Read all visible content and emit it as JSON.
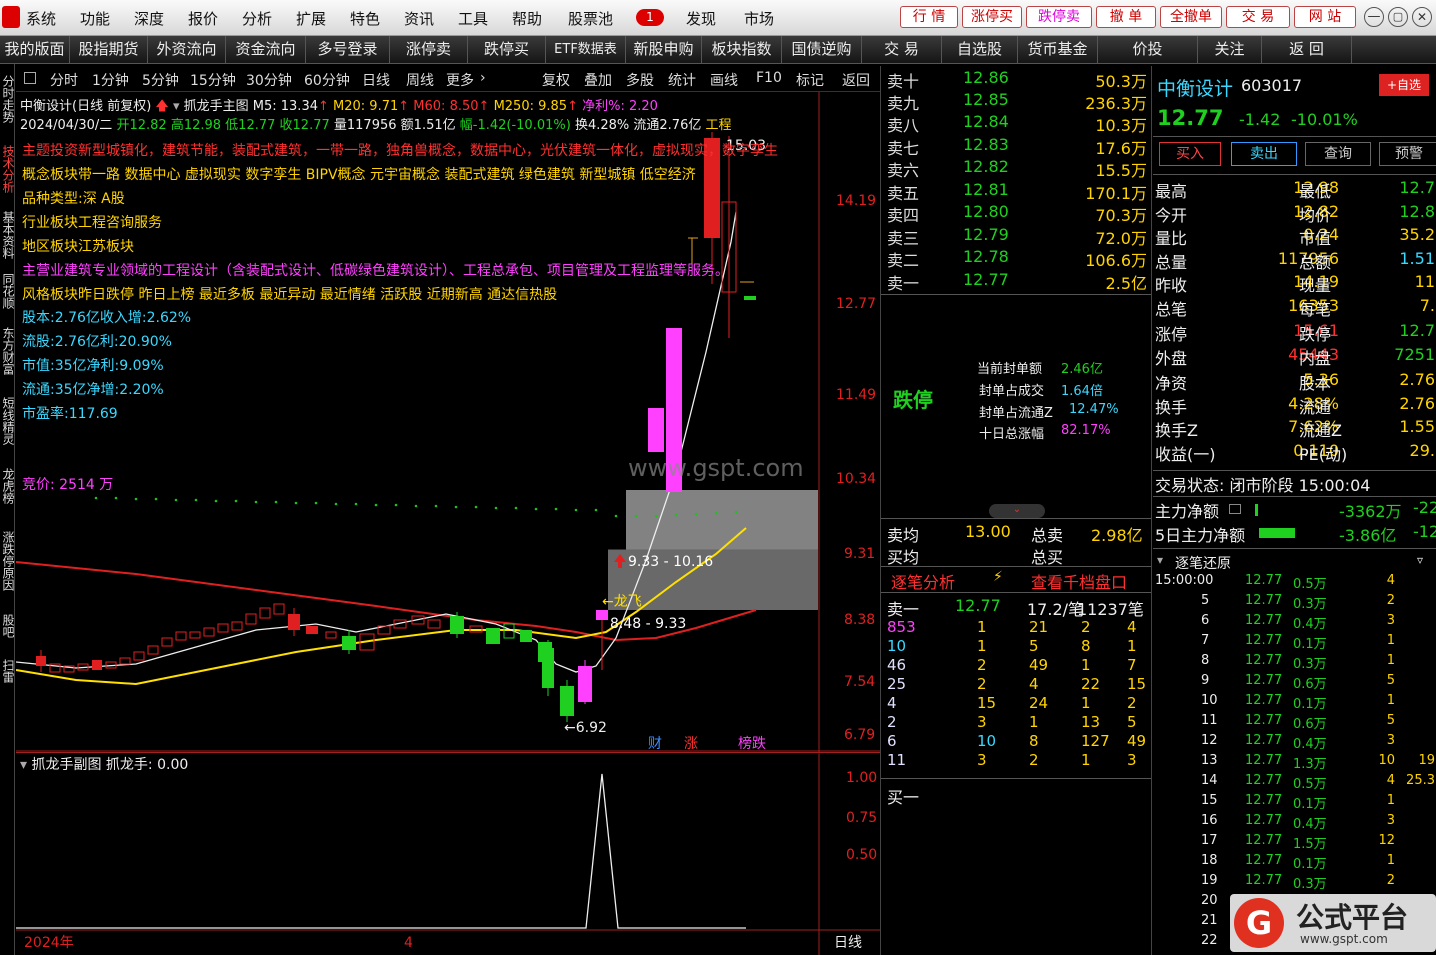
{
  "menu": {
    "items": [
      "系统",
      "功能",
      "深度",
      "报价",
      "分析",
      "扩展",
      "特色",
      "资讯",
      "工具",
      "帮助"
    ],
    "stockpool": "股票池",
    "badge": "1",
    "discover": "发现",
    "market": "市场",
    "right_buttons": [
      "行 情",
      "涨停买",
      "跌停卖",
      "撤 单",
      "全撤单",
      "交 易",
      "网 站"
    ]
  },
  "toolbar": {
    "items": [
      "我的版面",
      "股指期货",
      "外资流向",
      "资金流向",
      "多号登录",
      "涨停卖",
      "跌停买",
      "ETF数据表",
      "新股申购",
      "板块指数",
      "国债逆购",
      "交 易",
      "自选股",
      "货币基金",
      "价投",
      "关注",
      "返 回"
    ]
  },
  "leftstrip": [
    "分时走势",
    "技术分析",
    "基本资料",
    "同花顺",
    "东方财富",
    "短线精灵",
    "龙虎榜",
    "涨跌停原因",
    "股吧",
    "扫雷"
  ],
  "period": {
    "items": [
      "分时",
      "1分钟",
      "5分钟",
      "15分钟",
      "30分钟",
      "60分钟",
      "日线",
      "周线",
      "更多"
    ],
    "right": [
      "复权",
      "叠加",
      "多股",
      "统计",
      "画线",
      "F10",
      "标记",
      "返回"
    ]
  },
  "chart_header": {
    "title": "中衡设计(日线 前复权)",
    "main": "抓龙手主图",
    "m5": "M5: 13.34",
    "m20": "M20: 9.71",
    "m60": "M60: 8.50",
    "m250": "M250: 9.85",
    "jl": "净利%: 2.20",
    "line2a": "2024/04/30/二",
    "open": "开12.82",
    "high": "高12.98",
    "low": "低12.77",
    "close": "收12.77",
    "vol": "量117956",
    "amt": "额1.51亿",
    "chg": "幅-1.42(-10.01%)",
    "turn": "换4.28%",
    "flow": "流通2.76亿",
    "tail": "工程"
  },
  "overlay": {
    "theme": "主题投资新型城镇化，建筑节能，装配式建筑，一带一路，独角兽概念，数据中心，光伏建筑一体化，虚拟现实，数字孪生",
    "concept": "概念板块带一路 数据中心 虚拟现实 数字孪生 BIPV概念 元宇宙概念 装配式建筑 绿色建筑 新型城镇 低空经济",
    "type": "品种类型:深 A股",
    "industry": "行业板块工程咨询服务",
    "region": "地区板块江苏板块",
    "business": "主营业建筑专业领域的工程设计（含装配式设计、低碳绿色建筑设计）、工程总承包、项目管理及工程监理等服务。",
    "style": "风格板块昨日跌停 昨日上榜 最近多板 最近异动 最近情绪 活跃股 近期新高 通达信热股",
    "f1": "股本:2.76亿收入增:2.62%",
    "f2": "流股:2.76亿利:20.90%",
    "f3": "市值:35亿净利:9.09%",
    "f4": "流通:35亿净增:2.20%",
    "f5": "市盈率:117.69",
    "auction": "竞价: 2514 万"
  },
  "price_axis": [
    "14.19",
    "12.77",
    "11.49",
    "10.34",
    "9.31",
    "8.38",
    "7.54",
    "6.79"
  ],
  "sub_axis": [
    "1.00",
    "0.75",
    "0.50"
  ],
  "annotations": {
    "peak": "15.03",
    "zone": "9.33 - 10.16",
    "dragon": "←龙飞",
    "zone2": "8.48 - 9.33",
    "low": "←6.92",
    "tag1": "财",
    "tag2": "涨",
    "tag3": "榜跌",
    "watermark": "www.gspt.com"
  },
  "subchart": {
    "title": "抓龙手副图 抓龙手: 0.00",
    "year": "2024年",
    "month": "4",
    "period": "日线"
  },
  "orderbook": {
    "sells": [
      [
        "卖十",
        "12.86",
        "50.3万"
      ],
      [
        "卖九",
        "12.85",
        "236.3万"
      ],
      [
        "卖八",
        "12.84",
        "10.3万"
      ],
      [
        "卖七",
        "12.83",
        "17.6万"
      ],
      [
        "卖六",
        "12.82",
        "15.5万"
      ],
      [
        "卖五",
        "12.81",
        "170.1万"
      ],
      [
        "卖四",
        "12.80",
        "70.3万"
      ],
      [
        "卖三",
        "12.79",
        "72.0万"
      ],
      [
        "卖二",
        "12.78",
        "106.6万"
      ],
      [
        "卖一",
        "12.77",
        "2.5亿"
      ]
    ],
    "limit_label": "跌停",
    "seal_amt": "当前封单额",
    "seal_amt_v": "2.46亿",
    "seal_ratio": "封单占成交",
    "seal_ratio_v": "1.64倍",
    "seal_flow": "封单占流通Z",
    "seal_flow_v": "12.47%",
    "ten_day": "十日总涨幅",
    "ten_day_v": "82.17%",
    "sell_avg": "卖均",
    "sell_avg_v": "13.00",
    "total_sell": "总卖",
    "total_sell_v": "2.98亿",
    "buy_avg": "买均",
    "total_buy": "总买",
    "tabs": [
      "逐笔分析",
      "查看千档盘口"
    ],
    "s1": "卖一",
    "s1p": "12.77",
    "s1a": "17.2/笔",
    "s1n": "11237笔",
    "grid": [
      [
        "853",
        "1",
        "21",
        "2",
        "4"
      ],
      [
        "10",
        "1",
        "5",
        "8",
        "1"
      ],
      [
        "46",
        "2",
        "49",
        "1",
        "7"
      ],
      [
        "25",
        "2",
        "4",
        "22",
        "15"
      ],
      [
        "4",
        "15",
        "24",
        "1",
        "2"
      ],
      [
        "2",
        "3",
        "1",
        "13",
        "5"
      ],
      [
        "6",
        "10",
        "8",
        "127",
        "49"
      ],
      [
        "11",
        "3",
        "2",
        "1",
        "3"
      ]
    ],
    "b1": "买一"
  },
  "quote": {
    "name": "中衡设计",
    "code": "603017",
    "add": "+自选",
    "price": "12.77",
    "chg": "-1.42",
    "pct": "-10.01%",
    "btns": [
      "买入",
      "卖出",
      "查询",
      "预警"
    ],
    "rows": [
      [
        "最高",
        "12.98",
        "最低",
        "12.7"
      ],
      [
        "今开",
        "12.82",
        "均价",
        "12.8"
      ],
      [
        "量比",
        "0.24",
        "市值",
        "35.2"
      ],
      [
        "总量",
        "117956",
        "总额",
        "1.51"
      ],
      [
        "昨收",
        "14.19",
        "现量",
        "11"
      ],
      [
        "总笔",
        "16353",
        "每笔",
        "7."
      ],
      [
        "涨停",
        "15.61",
        "跌停",
        "12.7"
      ],
      [
        "外盘",
        "45443",
        "内盘",
        "7251"
      ],
      [
        "净资",
        "5.36",
        "股本",
        "2.76"
      ],
      [
        "换手",
        "4.28%",
        "流通",
        "2.76"
      ],
      [
        "换手Z",
        "7.62%",
        "流通Z",
        "1.55"
      ],
      [
        "收益(一)",
        "0.110",
        "PE(动)",
        "29."
      ]
    ],
    "status": "交易状态: 闭市阶段 15:00:04",
    "main_net": "主力净额",
    "main_net_v": "-3362万",
    "main_net_v2": "-22",
    "five_net": "5日主力净额",
    "five_net_v": "-3.86亿",
    "five_net_v2": "-12"
  },
  "ticks": {
    "title": "逐笔还原",
    "rows": [
      [
        "15:00:00",
        "12.77",
        "0.5万",
        "4",
        ""
      ],
      [
        "5",
        "12.77",
        "0.3万",
        "2",
        ""
      ],
      [
        "6",
        "12.77",
        "0.4万",
        "3",
        ""
      ],
      [
        "7",
        "12.77",
        "0.1万",
        "1",
        ""
      ],
      [
        "8",
        "12.77",
        "0.3万",
        "1",
        ""
      ],
      [
        "9",
        "12.77",
        "0.6万",
        "5",
        ""
      ],
      [
        "10",
        "12.77",
        "0.1万",
        "1",
        ""
      ],
      [
        "11",
        "12.77",
        "0.6万",
        "5",
        ""
      ],
      [
        "12",
        "12.77",
        "0.4万",
        "3",
        ""
      ],
      [
        "13",
        "12.77",
        "1.3万",
        "10",
        "19"
      ],
      [
        "14",
        "12.77",
        "0.5万",
        "4",
        "25.3"
      ],
      [
        "15",
        "12.77",
        "0.1万",
        "1",
        ""
      ],
      [
        "16",
        "12.77",
        "0.4万",
        "3",
        ""
      ],
      [
        "17",
        "12.77",
        "1.5万",
        "12",
        ""
      ],
      [
        "18",
        "12.77",
        "0.1万",
        "1",
        ""
      ],
      [
        "19",
        "12.77",
        "0.3万",
        "2",
        ""
      ],
      [
        "20",
        "",
        "",
        "",
        ""
      ],
      [
        "21",
        "",
        "",
        "",
        ""
      ],
      [
        "22",
        "",
        "",
        "",
        ""
      ]
    ]
  },
  "logo": {
    "text": "公式平台",
    "url": "www.gspt.com"
  }
}
